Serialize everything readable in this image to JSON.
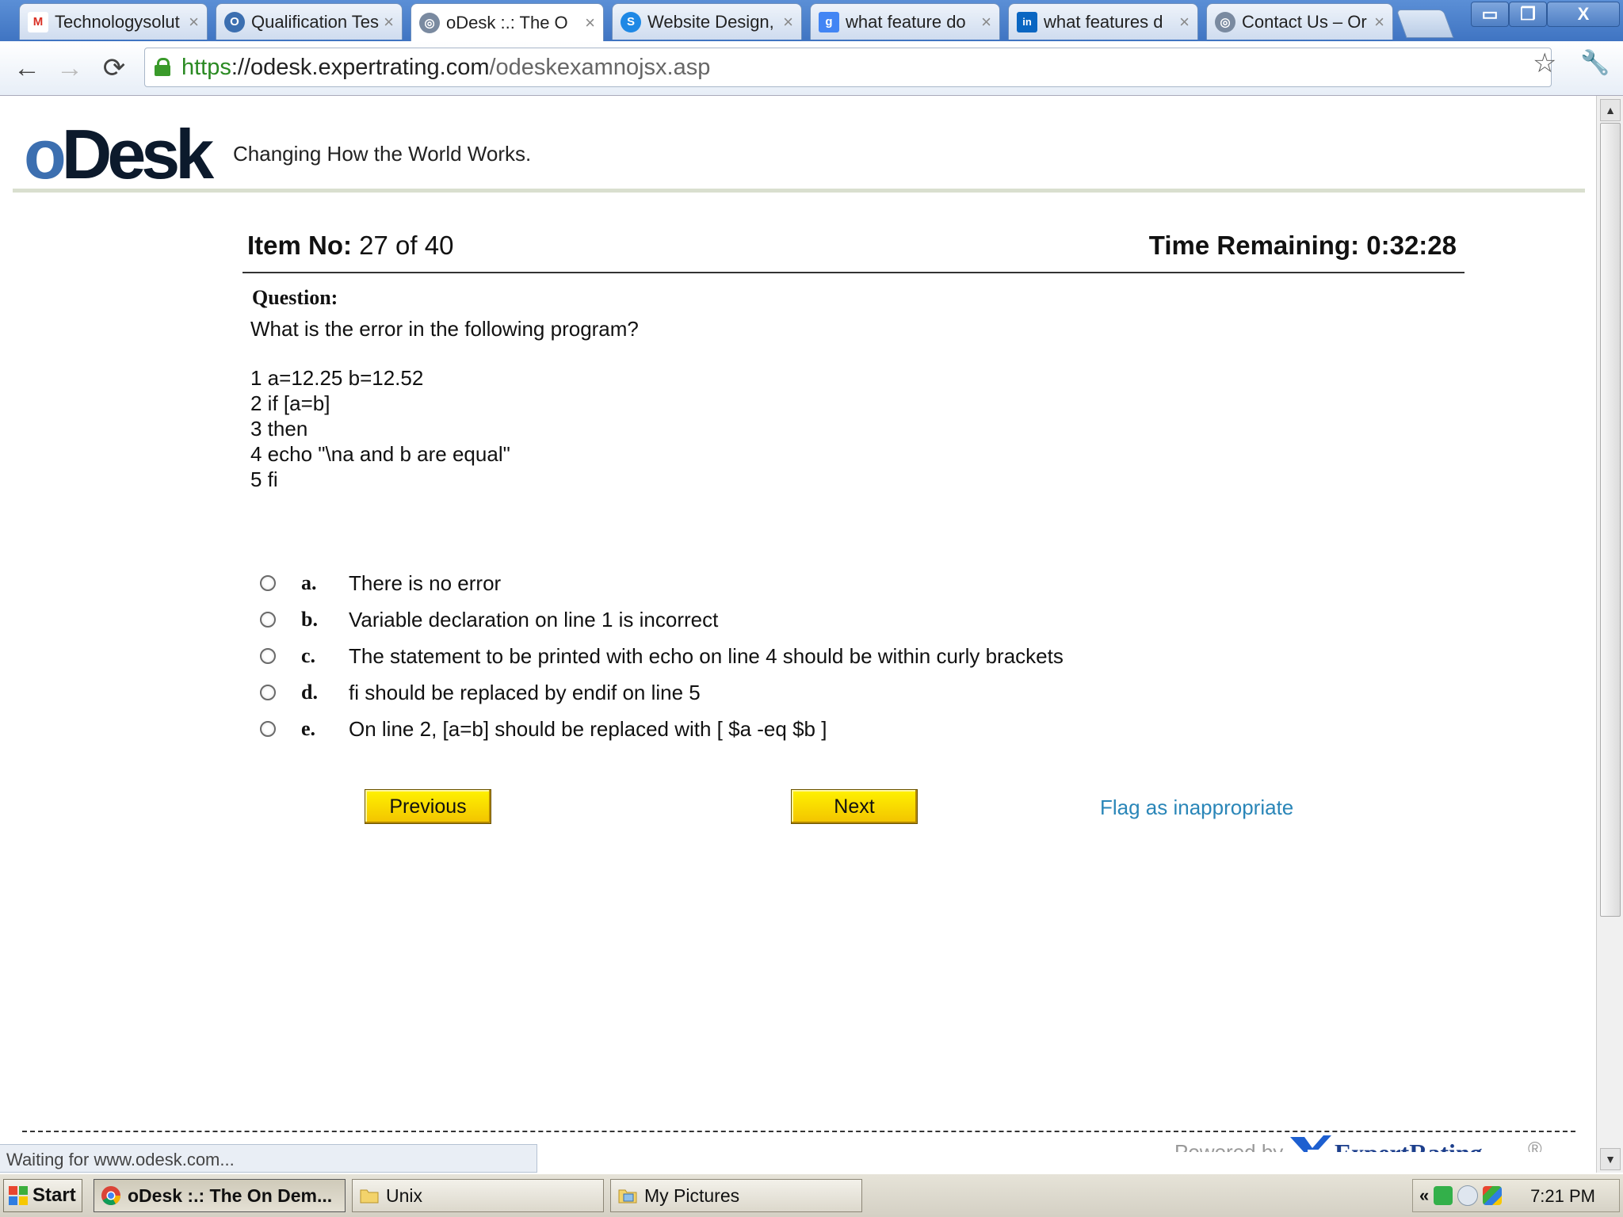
{
  "browser": {
    "tabs": [
      {
        "title": "Technologysolut",
        "icon": "gmail-icon",
        "color": "#d93025",
        "glyph": "M"
      },
      {
        "title": "Qualification Tes",
        "icon": "odesk-o-icon",
        "color": "#3c6fb0",
        "glyph": "O"
      },
      {
        "title": "oDesk :.: The O",
        "icon": "globe-icon",
        "color": "#7a8aa0",
        "glyph": "◎"
      },
      {
        "title": "Website Design,",
        "icon": "skype-icon",
        "color": "#1e88e5",
        "glyph": "S"
      },
      {
        "title": "what feature do",
        "icon": "google-icon",
        "color": "#4285f4",
        "glyph": "g"
      },
      {
        "title": "what features d",
        "icon": "linkedin-icon",
        "color": "#0a66c2",
        "glyph": "in"
      },
      {
        "title": "Contact Us – Or",
        "icon": "globe-icon",
        "color": "#7a8aa0",
        "glyph": "◎"
      }
    ],
    "window_controls": {
      "minimize": "▭",
      "restore": "❐",
      "close": "X"
    },
    "nav": {
      "back": "←",
      "forward": "→",
      "reload": "⟳"
    },
    "url": {
      "scheme": "https",
      "host": "://odesk.expertrating.com",
      "path": "/odeskexamnojsx.asp"
    },
    "status_text": "Waiting for www.odesk.com..."
  },
  "page": {
    "logo": {
      "o": "o",
      "desk": "Desk"
    },
    "tagline": "Changing How the World Works.",
    "item_label": "Item No:",
    "item_value": "27 of 40",
    "time_label": "Time Remaining:",
    "time_value": "0:32:28",
    "question_label": "Question:",
    "question_text": "What is the error in the following program?",
    "code_lines": [
      "1 a=12.25 b=12.52",
      "2 if [a=b]",
      "3 then",
      "4 echo \"\\na and b are equal\"",
      "5 fi"
    ],
    "options": [
      {
        "letter": "a.",
        "text": "There is no error"
      },
      {
        "letter": "b.",
        "text": "Variable declaration on line 1 is incorrect"
      },
      {
        "letter": "c.",
        "text": "The statement to be printed with echo on line 4 should be within curly brackets"
      },
      {
        "letter": "d.",
        "text": "fi should be replaced by endif on line 5"
      },
      {
        "letter": "e.",
        "text": "On line 2, [a=b] should be replaced with [ $a -eq $b ]"
      }
    ],
    "previous_label": "Previous",
    "next_label": "Next",
    "flag_label": "Flag as inappropriate",
    "powered_by": "Powered by",
    "expertrating": "ExpertRating",
    "registered": "®"
  },
  "taskbar": {
    "start_label": "Start",
    "buttons": [
      {
        "label": "oDesk :.: The On Dem...",
        "icon": "chrome-icon",
        "active": true
      },
      {
        "label": "Unix",
        "icon": "folder-icon",
        "active": false
      },
      {
        "label": "My Pictures",
        "icon": "pictures-folder-icon",
        "active": false
      }
    ],
    "tray_chevron": "«",
    "clock": "7:21 PM"
  },
  "colors": {
    "accent_link": "#2a86b8",
    "button_yellow": "#f2c300",
    "odesk_blue": "#3c6fb0",
    "expertrating_blue": "#1d3f8c"
  }
}
